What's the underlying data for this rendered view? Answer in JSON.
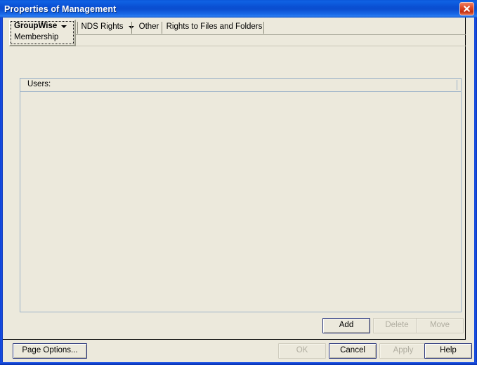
{
  "window": {
    "title": "Properties of Management",
    "close_icon": "close-icon",
    "accent_title_color": "#0a4fd2",
    "dialog_background": "#ece9dc"
  },
  "tabs": {
    "active": {
      "label": "GroupWise",
      "caret_icon": "chevron-down-icon",
      "subpage": "Membership"
    },
    "others": [
      {
        "label": "NDS Rights",
        "has_caret": true,
        "caret_icon": "chevron-down-icon"
      },
      {
        "label": "Other",
        "has_caret": false
      },
      {
        "label": "Rights to Files and Folders",
        "has_caret": false
      }
    ]
  },
  "users_panel": {
    "header_label": "Users:",
    "items": []
  },
  "list_actions": [
    {
      "label": "Add",
      "enabled": true
    },
    {
      "label": "Delete",
      "enabled": false
    },
    {
      "label": "Move",
      "enabled": false
    }
  ],
  "footer": {
    "page_options_label": "Page Options...",
    "ok_label": "OK",
    "cancel_label": "Cancel",
    "apply_label": "Apply",
    "help_label": "Help"
  }
}
